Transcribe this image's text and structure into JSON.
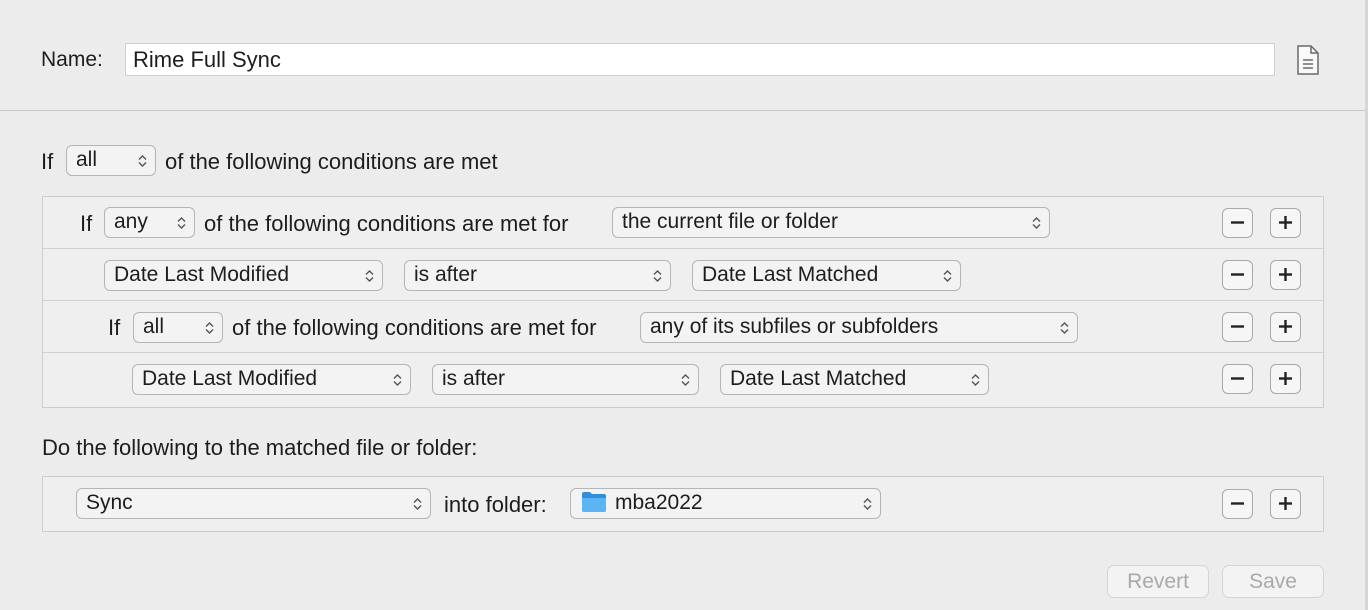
{
  "name_label": "Name:",
  "name_value": "Rime Full Sync",
  "outer": {
    "prefix": "If",
    "quantifier": "all",
    "suffix": "of the following conditions are met"
  },
  "group1": {
    "prefix": "If",
    "quantifier": "any",
    "suffix": "of the following conditions are met for",
    "target": "the current file or folder"
  },
  "cond1": {
    "attribute": "Date Last Modified",
    "operator": "is after",
    "value": "Date Last Matched"
  },
  "group2": {
    "prefix": "If",
    "quantifier": "all",
    "suffix": "of the following conditions are met for",
    "target": "any of its subfiles or subfolders"
  },
  "cond2": {
    "attribute": "Date Last Modified",
    "operator": "is after",
    "value": "Date Last Matched"
  },
  "action_heading": "Do the following to the matched file or folder:",
  "action": {
    "verb": "Sync",
    "into_label": "into folder:",
    "folder": "mba2022",
    "folder_icon": "folder-icon",
    "folder_color": "#3a9ee8"
  },
  "buttons": {
    "revert": "Revert",
    "save": "Save"
  }
}
